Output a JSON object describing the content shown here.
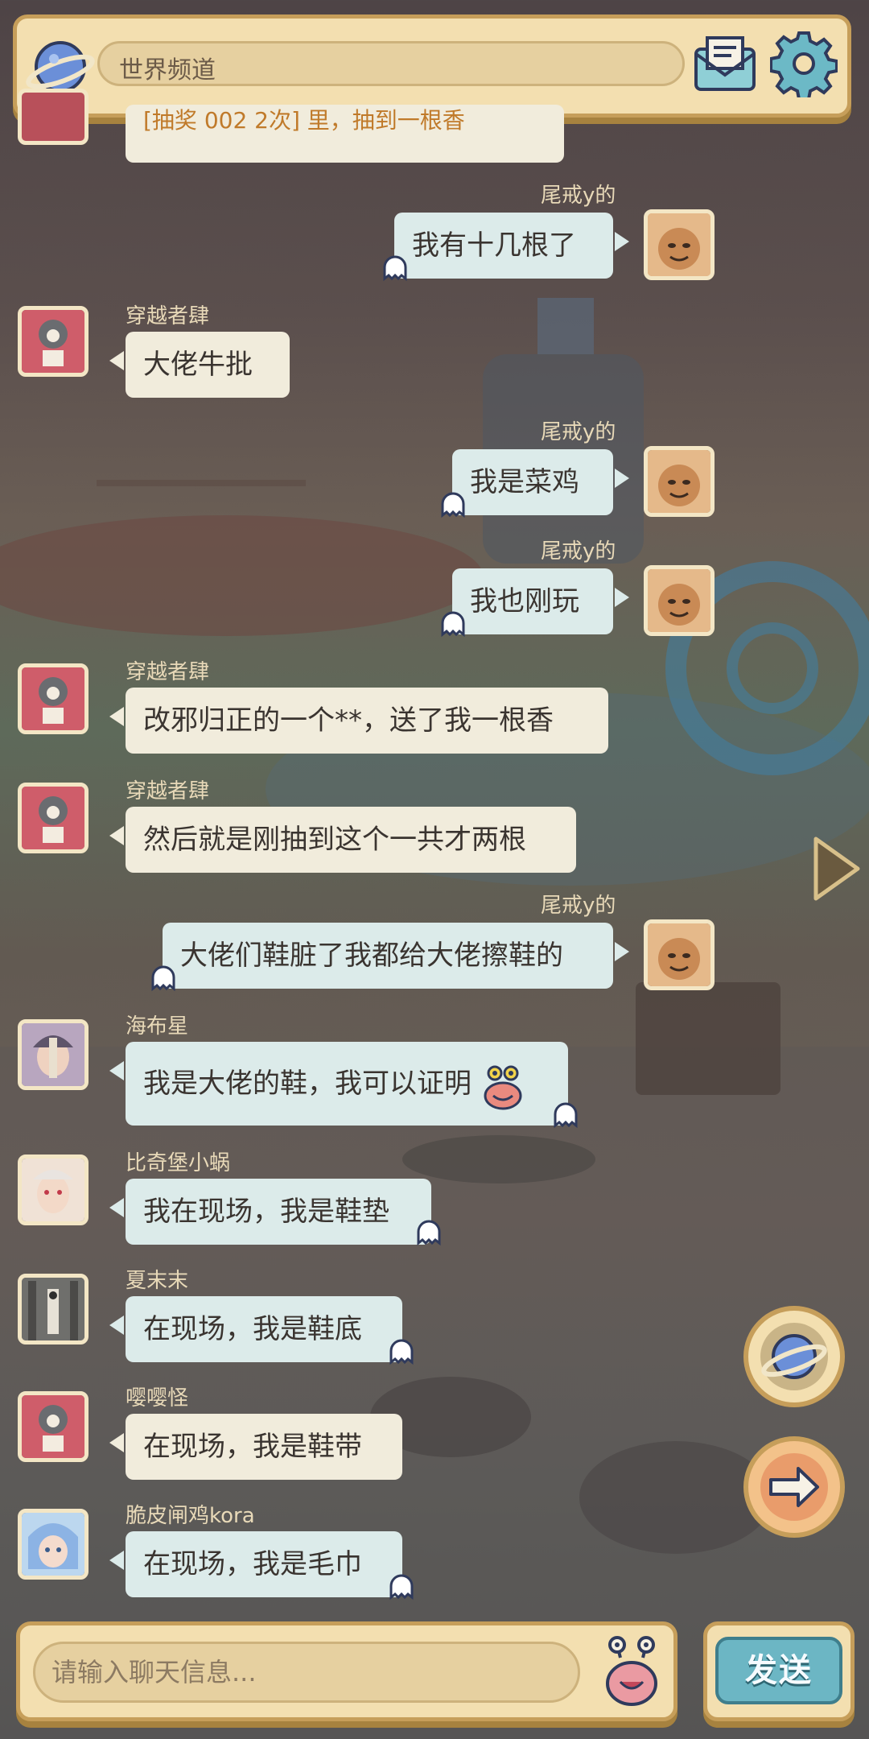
{
  "header": {
    "channel_title": "世界频道"
  },
  "messages": [
    {
      "sender": "",
      "text": "[抽奖 002 2次] 里，抽到一根香",
      "side": "left",
      "partial": true
    },
    {
      "sender": "尾戒y的",
      "text": "我有十几根了",
      "side": "right"
    },
    {
      "sender": "穿越者肆",
      "text": "大佬牛批",
      "side": "left"
    },
    {
      "sender": "尾戒y的",
      "text": "我是菜鸡",
      "side": "right"
    },
    {
      "sender": "尾戒y的",
      "text": "我也刚玩",
      "side": "right"
    },
    {
      "sender": "穿越者肆",
      "text": "改邪归正的一个**，送了我一根香",
      "side": "left"
    },
    {
      "sender": "穿越者肆",
      "text": "然后就是刚抽到这个一共才两根",
      "side": "left"
    },
    {
      "sender": "尾戒y的",
      "text": "大佬们鞋脏了我都给大佬擦鞋的",
      "side": "right"
    },
    {
      "sender": "海布星",
      "text": "我是大佬的鞋，我可以证明",
      "side": "left"
    },
    {
      "sender": "比奇堡小蜗",
      "text": "我在现场，我是鞋垫",
      "side": "left"
    },
    {
      "sender": "夏末末",
      "text": "在现场，我是鞋底",
      "side": "left"
    },
    {
      "sender": "嘤嘤怪",
      "text": "在现场，我是鞋带",
      "side": "left"
    },
    {
      "sender": "脆皮闸鸡kora",
      "text": "在现场，我是毛巾",
      "side": "left"
    }
  ],
  "input": {
    "placeholder": "请输入聊天信息..."
  },
  "send_button": {
    "label": "发送"
  },
  "icons": {
    "channel": "planet-icon",
    "mail": "mail-icon",
    "settings": "gear-icon",
    "emoji": "snail-emoji-icon",
    "world": "planet-icon",
    "share": "arrow-right-icon",
    "collapse": "triangle-right-icon"
  },
  "colors": {
    "panel": "#f3dfb0",
    "panel_border": "#c69e5a",
    "bubble_left": "#f1ecdc",
    "bubble_right": "#dcebea",
    "send": "#6cb6c4"
  }
}
